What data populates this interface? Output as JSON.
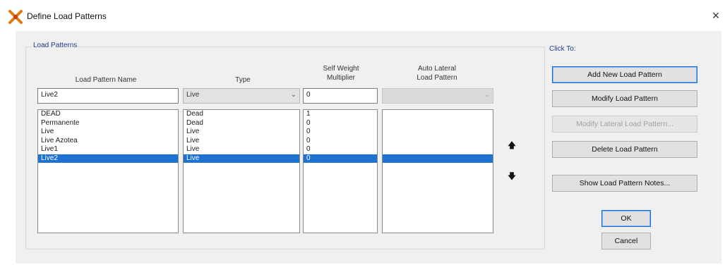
{
  "window": {
    "title": "Define Load Patterns",
    "close_symbol": "×"
  },
  "load_patterns": {
    "group_title": "Load Patterns",
    "columns": {
      "name": "Load Pattern Name",
      "type": "Type",
      "self_weight_line1": "Self Weight",
      "self_weight_line2": "Multiplier",
      "auto_lateral_line1": "Auto Lateral",
      "auto_lateral_line2": "Load Pattern"
    },
    "edit": {
      "name": "Live2",
      "type": "Live",
      "multiplier": "0",
      "auto_lateral": ""
    },
    "rows": [
      {
        "name": "DEAD",
        "type": "Dead",
        "multiplier": "1",
        "auto_lateral": ""
      },
      {
        "name": "Permanente",
        "type": "Dead",
        "multiplier": "0",
        "auto_lateral": ""
      },
      {
        "name": "Live",
        "type": "Live",
        "multiplier": "0",
        "auto_lateral": ""
      },
      {
        "name": "Live Azotea",
        "type": "Live",
        "multiplier": "0",
        "auto_lateral": ""
      },
      {
        "name": "Live1",
        "type": "Live",
        "multiplier": "0",
        "auto_lateral": ""
      },
      {
        "name": "Live2",
        "type": "Live",
        "multiplier": "0",
        "auto_lateral": ""
      }
    ],
    "selected_index": 5
  },
  "click_to": {
    "group_title": "Click To:",
    "add_new": "Add New Load Pattern",
    "modify": "Modify Load Pattern",
    "modify_lateral": "Modify Lateral Load Pattern...",
    "delete": "Delete Load Pattern",
    "show_notes": "Show Load Pattern Notes..."
  },
  "ok_label": "OK",
  "cancel_label": "Cancel",
  "colors": {
    "selection": "#1e73d2",
    "group_title": "#1f3a8a",
    "dialog_bg": "#f0f0f0"
  },
  "icons": {
    "app": "structure-x-icon",
    "move_up": "arrow-up-icon",
    "move_down": "arrow-down-icon",
    "combo": "chevron-down-icon"
  }
}
